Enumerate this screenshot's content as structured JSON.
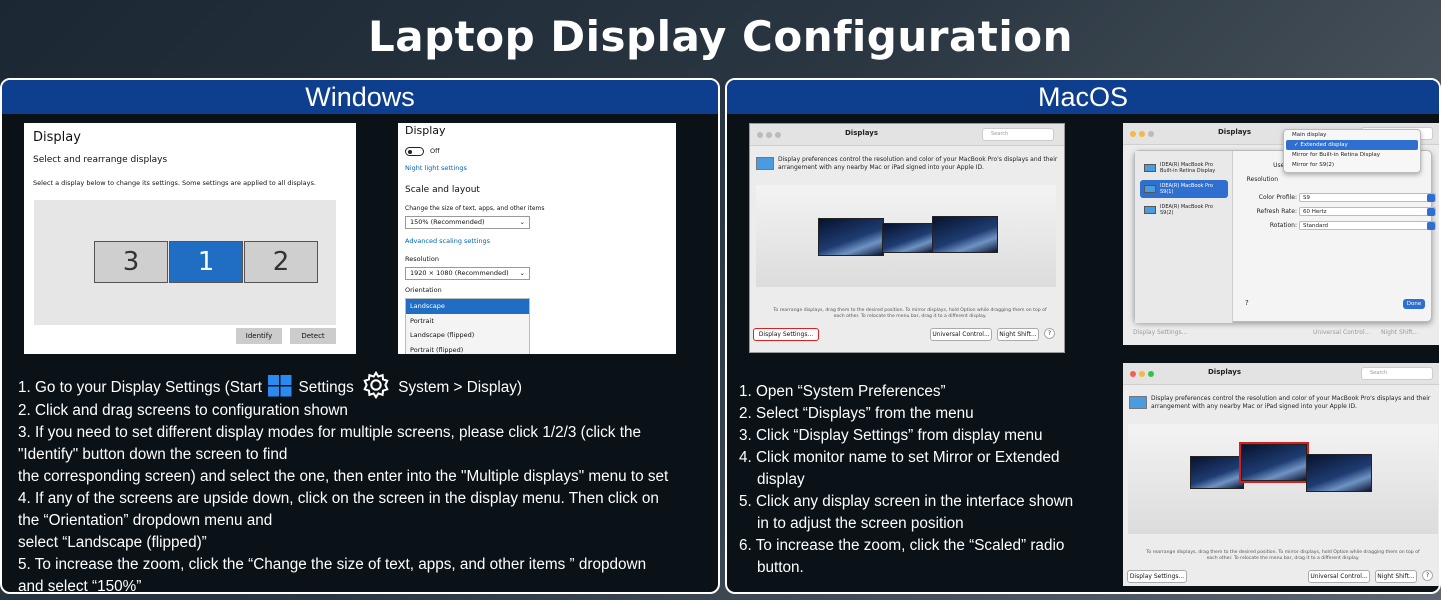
{
  "title": "Laptop Display Configuration",
  "windows": {
    "header": "Windows",
    "shot1": {
      "heading": "Display",
      "subheading": "Select and rearrange displays",
      "desc": "Select a display below to change its settings. Some settings are applied to all displays.",
      "monitors": [
        "3",
        "1",
        "2"
      ],
      "identify": "Identify",
      "detect": "Detect"
    },
    "shot2": {
      "heading": "Display",
      "toggle_label": "Off",
      "night_light": "Night light settings",
      "scale_layout": "Scale and layout",
      "change_size": "Change the size of text, apps, and other items",
      "scale_value": "150% (Recommended)",
      "advanced": "Advanced scaling settings",
      "resolution_label": "Resolution",
      "resolution_value": "1920 × 1080 (Recommended)",
      "orientation_label": "Orientation",
      "orientation_options": [
        "Landscape",
        "Portrait",
        "Landscape (flipped)",
        "Portrait (flipped)"
      ]
    },
    "instructions": {
      "l1a": "1. Go to your Display Settings (Start",
      "l1b": "Settings",
      "l1c": "System > Display)",
      "l2": "2. Click and drag screens to configuration shown",
      "l3a": "3. If you need to set different display modes for multiple screens, please click 1/2/3 (click the",
      "l3b": "\"Identify\" button down the screen to find",
      "l3c": "the corresponding screen) and select the one, then enter into the \"Multiple displays\" menu to set",
      "l4a": "4. If any of the screens are upside down, click on the screen in the display menu. Then click on",
      "l4b": "the “Orientation” dropdown menu and",
      "l4c": "select “Landscape (flipped)”",
      "l5a": "5. To increase the zoom, click the “Change the size of text, apps, and other items ” dropdown",
      "l5b": "and select “150%”"
    }
  },
  "mac": {
    "header": "MacOS",
    "shot1": {
      "window_title": "Displays",
      "search": "Search",
      "desc": "Display preferences control the resolution and color of your MacBook Pro's displays and their arrangement with any nearby Mac or iPad signed into your Apple ID.",
      "hint": "To rearrange displays, drag them to the desired position. To mirror displays, hold Option while dragging them on top of each other. To relocate the menu bar, drag it to a different display.",
      "display_settings": "Display Settings...",
      "universal_control": "Universal Control...",
      "night_shift": "Night Shift...",
      "help": "?"
    },
    "shot2": {
      "window_title": "Displays",
      "search": "Search",
      "side_items": [
        {
          "name": "IDEA(R) MacBook Pro",
          "sub": "Built-in Retina Display"
        },
        {
          "name": "IDEA(R) MacBook Pro",
          "sub": "S9(1)"
        },
        {
          "name": "IDEA(R) MacBook Pro",
          "sub": "S9(2)"
        }
      ],
      "use_as_label": "Use as",
      "resolution_label": "Resolution",
      "menu_options": [
        "Main display",
        "✓ Extended display",
        "Mirror for Built-in Retina Display",
        "Mirror for S9(2)"
      ],
      "color_profile_label": "Color Profile:",
      "color_profile_value": "S9",
      "refresh_label": "Refresh Rate:",
      "refresh_value": "60 Hertz",
      "rotation_label": "Rotation:",
      "rotation_value": "Standard",
      "help": "?",
      "done": "Done",
      "bg_display_settings": "Display Settings...",
      "bg_universal": "Universal Control...",
      "bg_night": "Night Shift..."
    },
    "shot3": {
      "window_title": "Displays",
      "search": "Search",
      "desc": "Display preferences control the resolution and color of your MacBook Pro's displays and their arrangement with any nearby Mac or iPad signed into your Apple ID.",
      "hint": "To rearrange displays, drag them to the desired position. To mirror displays, hold Option while dragging them on top of each other. To relocate the menu bar, drag it to a different display.",
      "display_settings": "Display Settings...",
      "universal_control": "Universal Control...",
      "night_shift": "Night Shift...",
      "help": "?"
    },
    "instructions": {
      "l1": "1. Open “System Preferences”",
      "l2": "2. Select “Displays” from the menu",
      "l3": "3. Click “Display Settings” from display menu",
      "l4a": "4. Click monitor name to set Mirror or Extended",
      "l4b": "display",
      "l5a": "5. Click any display screen in the interface shown",
      "l5b": "in to adjust the screen position",
      "l6a": "6. To increase the zoom, click the “Scaled” radio",
      "l6b": "button."
    }
  },
  "colors": {
    "header_blue": "#0e3f8e",
    "selected_blue": "#1f6ec4",
    "mac_blue": "#2f6fd0",
    "highlight_red": "#d32020"
  }
}
